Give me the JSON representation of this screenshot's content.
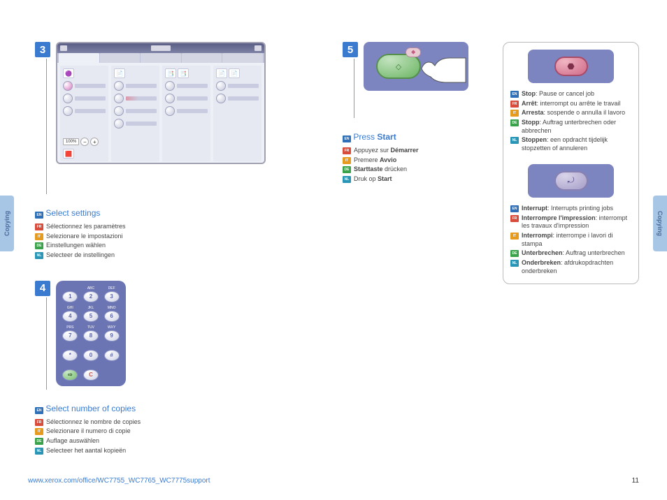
{
  "tab_label": "Copying",
  "step3": {
    "num": "3",
    "title_prefix": "Select ",
    "title_rest": "settings",
    "zoom": "100%",
    "fr": "Sélectionnez les paramètres",
    "it": "Selezionare le impostazioni",
    "de": "Einstellungen wählen",
    "nl": "Selecteer de instellingen"
  },
  "step4": {
    "num": "4",
    "title_prefix": "Select ",
    "title_rest": "number of copies",
    "fr": "Sélectionnez le nombre de copies",
    "it": "Selezionare il numero di copie",
    "de": "Auflage auswählen",
    "nl": "Selecteer het aantal kopieën",
    "keys": {
      "lab1": "",
      "lab2": "ABC",
      "lab3": "DEF",
      "lab4": "GHI",
      "lab5": "JKL",
      "lab6": "MNO",
      "lab7": "PRS",
      "lab8": "TUV",
      "lab9": "WXY",
      "k1": "1",
      "k2": "2",
      "k3": "3",
      "k4": "4",
      "k5": "5",
      "k6": "6",
      "k7": "7",
      "k8": "8",
      "k9": "9",
      "kstar": "*",
      "k0": "0",
      "khash": "#",
      "kC": "C"
    }
  },
  "step5": {
    "num": "5",
    "title_prefix": "Press ",
    "title_bold": "Start",
    "fr_pre": "Appuyez sur ",
    "fr_b": "Démarrer",
    "it_pre": "Premere ",
    "it_b": "Avvio",
    "de_b": "Starttaste",
    "de_post": " drücken",
    "nl_pre": "Druk op ",
    "nl_b": "Start"
  },
  "stop": {
    "en_b": "Stop",
    "en_post": ": Pause or cancel job",
    "fr_b": "Arrêt",
    "fr_post": ": interrompt ou arrête le travail",
    "it_b": "Arresta",
    "it_post": ": sospende o annulla il lavoro",
    "de_b": "Stopp",
    "de_post": ": Auftrag unterbrechen oder abbrechen",
    "nl_b": "Stoppen",
    "nl_post": ": een opdracht tijdelijk stopzetten of annuleren"
  },
  "interrupt": {
    "en_b": "Interrupt",
    "en_post": ": Interrupts printing jobs",
    "fr_b": "Interrompre l'impression",
    "fr_post": ": interrompt les travaux d'impression",
    "it_b": "Interrompi",
    "it_post": ": interrompe i lavori di stampa",
    "de_b": "Unterbrechen",
    "de_post": ": Auftrag unterbrechen",
    "nl_b": "Onderbreken",
    "nl_post": ": afdrukopdrachten onderbreken"
  },
  "footer_url": "www.xerox.com/office/WC7755_WC7765_WC7775support",
  "page_number": "11"
}
